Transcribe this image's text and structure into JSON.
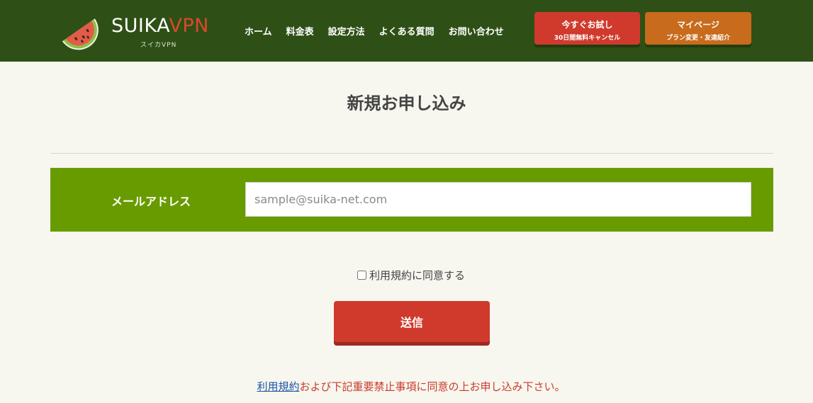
{
  "header": {
    "logo": {
      "brand_main": "SUIKA",
      "brand_accent": "VPN",
      "sub": "スイカVPN"
    },
    "nav": [
      "ホーム",
      "料金表",
      "設定方法",
      "よくある質問",
      "お問い合わせ"
    ],
    "trial_button": {
      "line1": "今すぐお試し",
      "line2": "30日間無料キャンセル"
    },
    "mypage_button": {
      "line1": "マイページ",
      "line2": "プラン変更・友達紹介"
    }
  },
  "main": {
    "title": "新規お申し込み",
    "email_label": "メールアドレス",
    "email_placeholder": "sample@suika-net.com",
    "email_value": "",
    "agree_label": "利用規約に同意する",
    "submit_label": "送信",
    "notice_link": "利用規約",
    "notice_text": "および下記重要禁止事項に同意の上お申し込み下さい。"
  },
  "colors": {
    "header_bg": "#2e5016",
    "accent_red": "#cf3a2d",
    "accent_orange": "#c86b1c",
    "form_green": "#689b00"
  }
}
